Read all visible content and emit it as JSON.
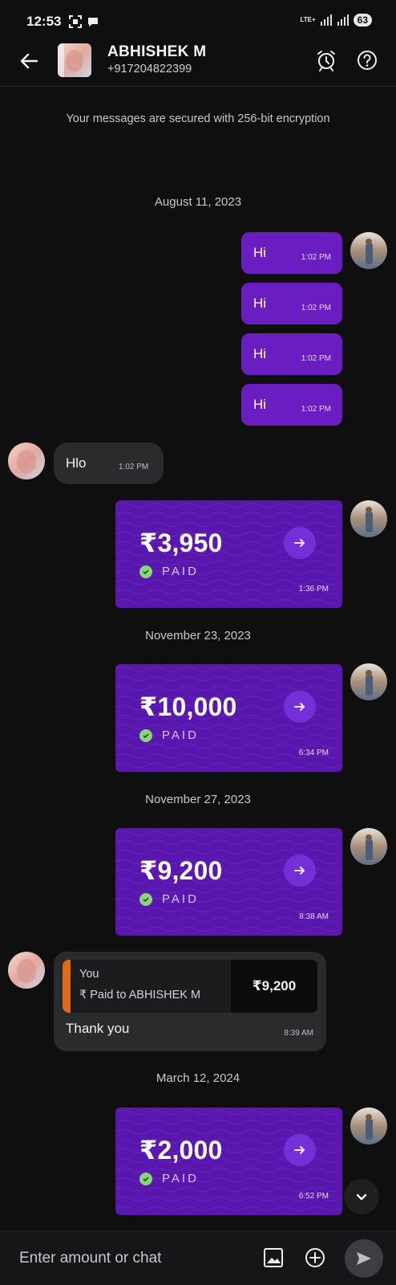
{
  "status_bar": {
    "time": "12:53",
    "network": "LTE+",
    "battery": "63"
  },
  "header": {
    "name": "ABHISHEK M",
    "phone": "+917204822399"
  },
  "encryption_note": "Your messages are secured with 256-bit encryption",
  "dates": [
    "August 11, 2023",
    "November 23, 2023",
    "November 27, 2023",
    "March 12, 2024"
  ],
  "sent_messages": [
    {
      "text": "Hi",
      "time": "1:02 PM"
    },
    {
      "text": "Hi",
      "time": "1:02 PM"
    },
    {
      "text": "Hi",
      "time": "1:02 PM"
    },
    {
      "text": "Hi",
      "time": "1:02 PM"
    }
  ],
  "received_message": {
    "text": "Hlo",
    "time": "1:02 PM"
  },
  "payments": [
    {
      "amount": "₹3,950",
      "status": "PAID",
      "time": "1:36 PM"
    },
    {
      "amount": "₹10,000",
      "status": "PAID",
      "time": "6:34 PM"
    },
    {
      "amount": "₹9,200",
      "status": "PAID",
      "time": "8:38 AM"
    },
    {
      "amount": "₹2,000",
      "status": "PAID",
      "time": "6:52 PM"
    }
  ],
  "reply": {
    "quote_sender": "You",
    "quote_currency_symbol": "₹",
    "quote_text": "Paid to ABHISHEK M",
    "quote_amount": "₹9,200",
    "text": "Thank you",
    "time": "8:39 AM"
  },
  "composer": {
    "placeholder": "Enter amount or chat"
  },
  "colors": {
    "background": "#0f0f10",
    "sent_bubble": "#6a1ec2",
    "payment_card": "#5a17ad",
    "received_bubble": "#2b2b2e",
    "paid_check": "#8ad57c",
    "quote_accent": "#e16a1a"
  },
  "icons": {
    "back": "arrow-left-icon",
    "alarm": "alarm-clock-icon",
    "help": "question-circle-icon",
    "image": "image-icon",
    "add": "plus-circle-icon",
    "send": "send-icon",
    "scroll": "chevron-down-icon"
  }
}
